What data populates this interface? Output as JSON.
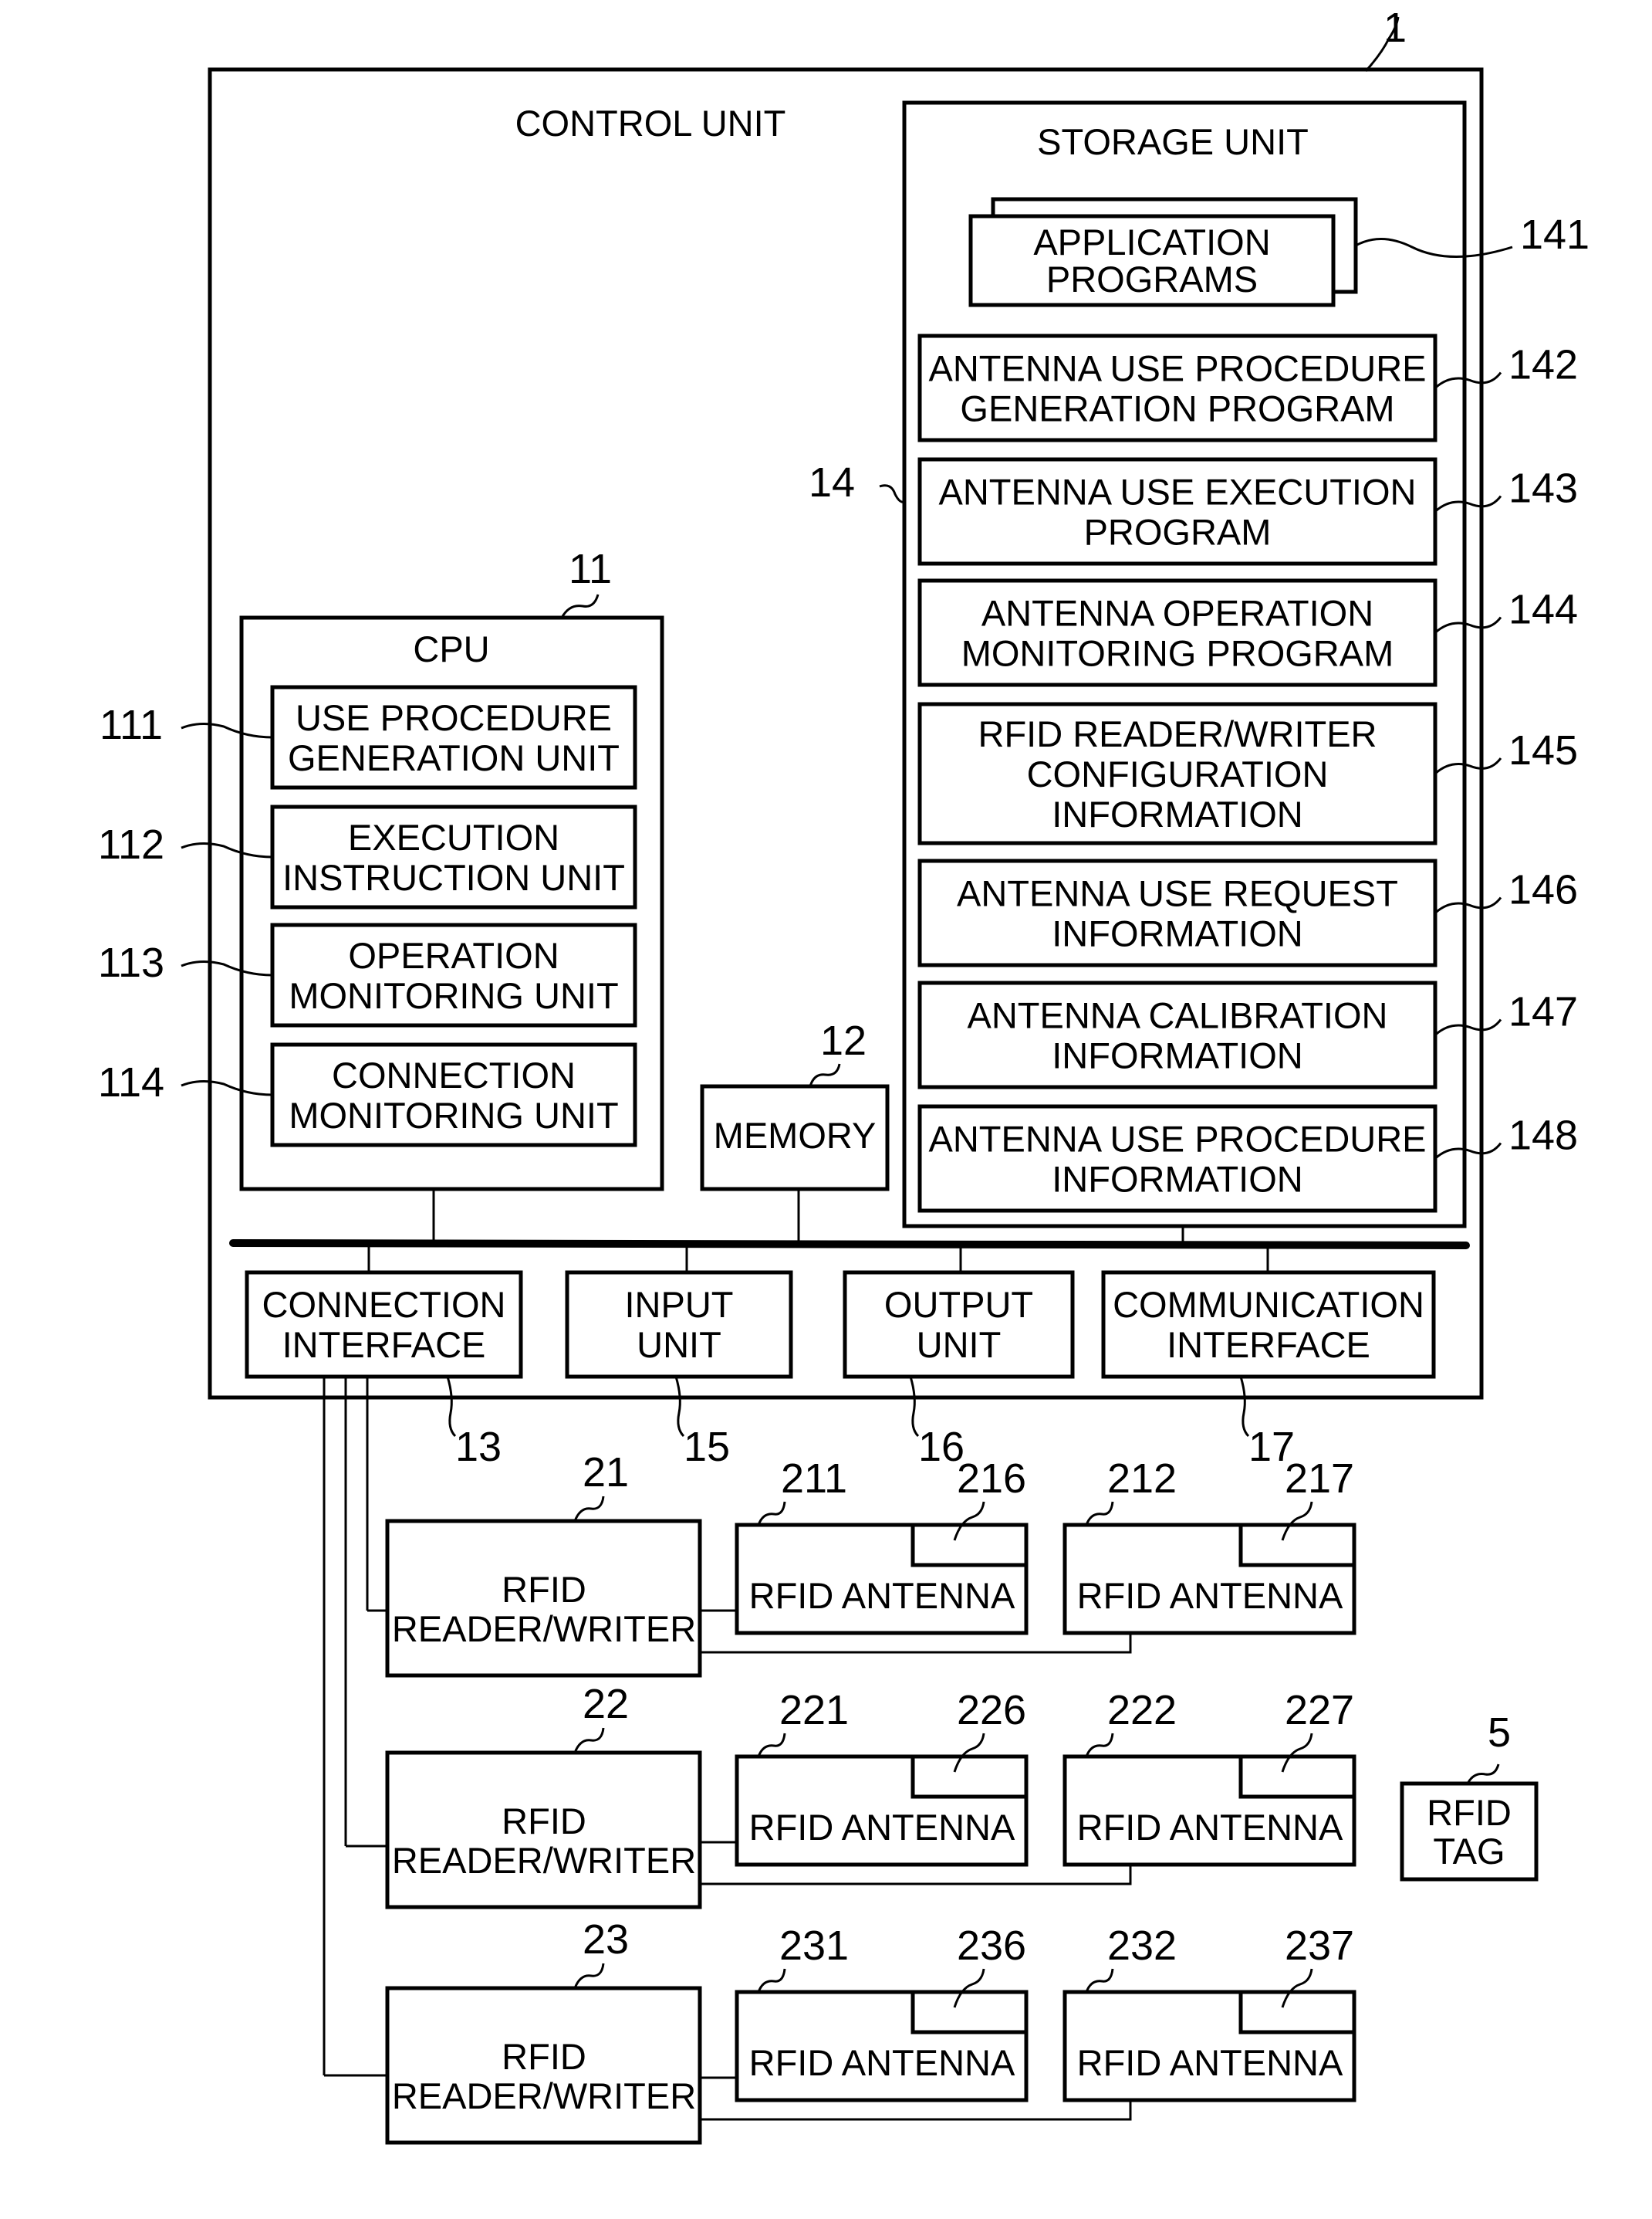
{
  "figure": {
    "system_ref": "1",
    "control_unit": {
      "label": "CONTROL UNIT"
    },
    "storage_unit": {
      "label": "STORAGE UNIT",
      "ref": "14",
      "items": [
        {
          "ref": "141",
          "lines": [
            "APPLICATION",
            "PROGRAMS"
          ]
        },
        {
          "ref": "142",
          "lines": [
            "ANTENNA USE PROCEDURE",
            "GENERATION PROGRAM"
          ]
        },
        {
          "ref": "143",
          "lines": [
            "ANTENNA USE EXECUTION",
            "PROGRAM"
          ]
        },
        {
          "ref": "144",
          "lines": [
            "ANTENNA OPERATION",
            "MONITORING PROGRAM"
          ]
        },
        {
          "ref": "145",
          "lines": [
            "RFID READER/WRITER",
            "CONFIGURATION",
            "INFORMATION"
          ]
        },
        {
          "ref": "146",
          "lines": [
            "ANTENNA USE REQUEST",
            "INFORMATION"
          ]
        },
        {
          "ref": "147",
          "lines": [
            "ANTENNA CALIBRATION",
            "INFORMATION"
          ]
        },
        {
          "ref": "148",
          "lines": [
            "ANTENNA USE PROCEDURE",
            "INFORMATION"
          ]
        }
      ]
    },
    "cpu": {
      "label": "CPU",
      "ref": "11",
      "units": [
        {
          "ref": "111",
          "lines": [
            "USE PROCEDURE",
            "GENERATION UNIT"
          ]
        },
        {
          "ref": "112",
          "lines": [
            "EXECUTION",
            "INSTRUCTION UNIT"
          ]
        },
        {
          "ref": "113",
          "lines": [
            "OPERATION",
            "MONITORING UNIT"
          ]
        },
        {
          "ref": "114",
          "lines": [
            "CONNECTION",
            "MONITORING UNIT"
          ]
        }
      ]
    },
    "memory": {
      "label": "MEMORY",
      "ref": "12"
    },
    "interfaces": [
      {
        "ref": "13",
        "lines": [
          "CONNECTION",
          "INTERFACE"
        ]
      },
      {
        "ref": "15",
        "lines": [
          "INPUT",
          "UNIT"
        ]
      },
      {
        "ref": "16",
        "lines": [
          "OUTPUT",
          "UNIT"
        ]
      },
      {
        "ref": "17",
        "lines": [
          "COMMUNICATION",
          "INTERFACE"
        ]
      }
    ],
    "reader_rows": [
      {
        "reader": {
          "ref": "21",
          "lines": [
            "RFID",
            "READER/WRITER"
          ]
        },
        "antennas": [
          {
            "ref": "211",
            "sub_ref": "216",
            "label": "RFID ANTENNA"
          },
          {
            "ref": "212",
            "sub_ref": "217",
            "label": "RFID ANTENNA"
          }
        ]
      },
      {
        "reader": {
          "ref": "22",
          "lines": [
            "RFID",
            "READER/WRITER"
          ]
        },
        "antennas": [
          {
            "ref": "221",
            "sub_ref": "226",
            "label": "RFID ANTENNA"
          },
          {
            "ref": "222",
            "sub_ref": "227",
            "label": "RFID ANTENNA"
          }
        ]
      },
      {
        "reader": {
          "ref": "23",
          "lines": [
            "RFID",
            "READER/WRITER"
          ]
        },
        "antennas": [
          {
            "ref": "231",
            "sub_ref": "236",
            "label": "RFID ANTENNA"
          },
          {
            "ref": "232",
            "sub_ref": "237",
            "label": "RFID ANTENNA"
          }
        ]
      }
    ],
    "rfid_tag": {
      "ref": "5",
      "lines": [
        "RFID",
        "TAG"
      ]
    }
  }
}
